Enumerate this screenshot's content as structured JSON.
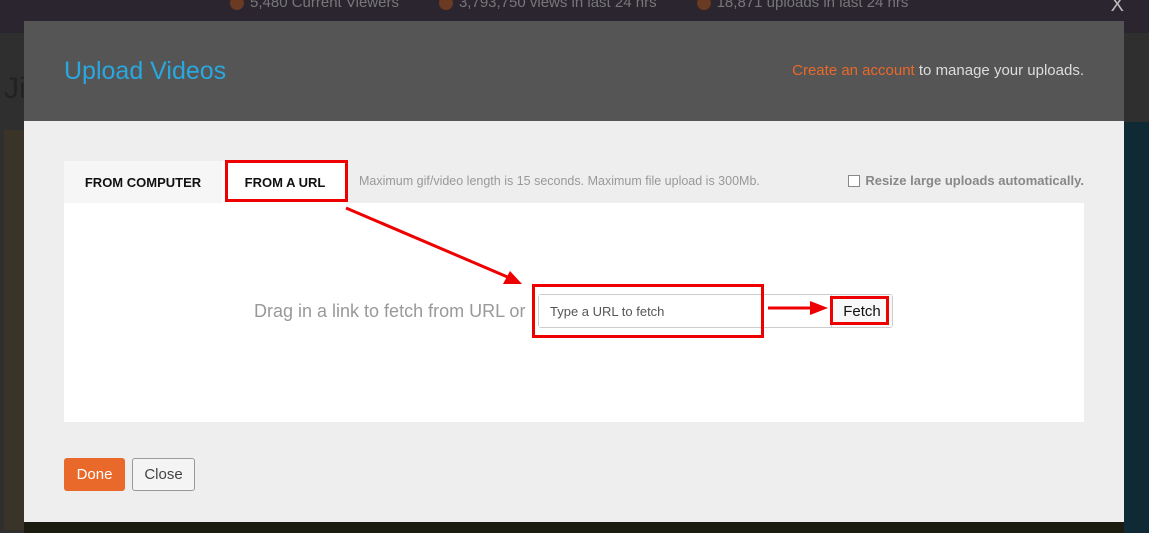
{
  "background": {
    "stats": [
      "5,480 Current Viewers",
      "3,793,750 views in last 24 hrs",
      "18,871 uploads in last 24 hrs"
    ],
    "close_glyph": "X",
    "page_title_partial": "Ji"
  },
  "modal": {
    "title": "Upload Videos",
    "account_link": "Create an account",
    "account_suffix": " to manage your uploads.",
    "tabs": [
      {
        "label": "FROM COMPUTER",
        "active": false
      },
      {
        "label": "FROM A URL",
        "active": true
      }
    ],
    "note": "Maximum gif/video length is 15 seconds. Maximum file upload is 300Mb.",
    "resize_label": "Resize large uploads automatically.",
    "resize_checked": false,
    "drag_text": "Drag in a link to fetch from URL or",
    "url_input": {
      "value": "",
      "placeholder": "Type a URL to fetch"
    },
    "fetch_label": "Fetch",
    "done_label": "Done",
    "close_label": "Close"
  },
  "colors": {
    "accent_blue": "#29a8e0",
    "accent_orange": "#e8692a",
    "annotation_red": "#ee0000"
  }
}
